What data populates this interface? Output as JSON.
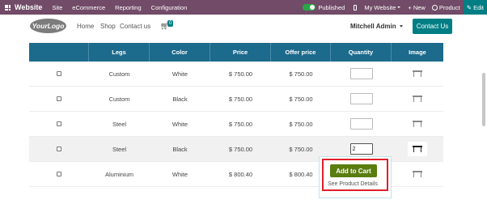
{
  "topbar": {
    "brand": "Website",
    "menu": [
      "Site",
      "eCommerce",
      "Reporting",
      "Configuration"
    ],
    "published": "Published",
    "my_website": "My Website",
    "new": "+ New",
    "product": "Product",
    "edit": "✎ Edit"
  },
  "header": {
    "logo": "YourLogo",
    "nav": [
      "Home",
      "Shop",
      "Contact us"
    ],
    "cart_count": "0",
    "user": "Mitchell Admin",
    "contact_button": "Contact Us"
  },
  "table": {
    "columns": [
      "",
      "Legs",
      "Color",
      "Price",
      "Offer price",
      "Quantity",
      "Image"
    ],
    "rows": [
      {
        "legs": "Custom",
        "color": "White",
        "price": "$ 750.00",
        "offer": "$ 750.00",
        "qty": ""
      },
      {
        "legs": "Custom",
        "color": "Black",
        "price": "$ 750.00",
        "offer": "$ 750.00",
        "qty": ""
      },
      {
        "legs": "Steel",
        "color": "White",
        "price": "$ 750.00",
        "offer": "$ 750.00",
        "qty": ""
      },
      {
        "legs": "Steel",
        "color": "Black",
        "price": "$ 750.00",
        "offer": "$ 750.00",
        "qty": "2"
      },
      {
        "legs": "Aluminium",
        "color": "White",
        "price": "$ 800.40",
        "offer": "$ 800.40",
        "qty": ""
      }
    ]
  },
  "popup": {
    "add_to_cart": "Add to Cart",
    "see_details": "See Product Details"
  },
  "colors": {
    "topbar": "#714b67",
    "teal": "#017e84",
    "table_header": "#1c6a8c",
    "add_to_cart": "#5a7d10",
    "highlight": "#e1202a"
  }
}
